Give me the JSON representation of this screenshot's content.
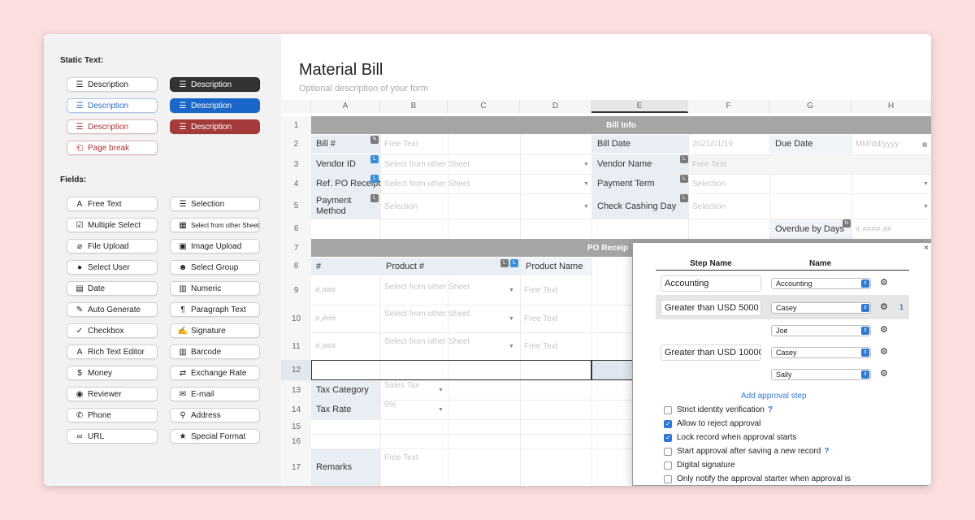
{
  "window": {
    "dots": [
      "#ed6a5e",
      "#f5bf4f",
      "#62c554"
    ]
  },
  "sidebar": {
    "static_title": "Static Text:",
    "static_items": [
      {
        "label": "Description",
        "icon": "align-lines-icon",
        "style": "plain"
      },
      {
        "label": "Description",
        "icon": "align-lines-icon",
        "style": "dark"
      },
      {
        "label": "Description",
        "icon": "align-lines-icon",
        "style": "blue-outline"
      },
      {
        "label": "Description",
        "icon": "align-lines-icon",
        "style": "blue-filled"
      },
      {
        "label": "Description",
        "icon": "align-lines-icon",
        "style": "red-outline"
      },
      {
        "label": "Description",
        "icon": "align-lines-icon",
        "style": "red-filled"
      },
      {
        "label": "Page break",
        "icon": "page-break-icon",
        "style": "red-outline"
      }
    ],
    "fields_title": "Fields:",
    "fields": [
      {
        "label": "Free Text",
        "icon": "font-icon",
        "glyph": "A"
      },
      {
        "label": "Selection",
        "icon": "list-icon",
        "glyph": "☰"
      },
      {
        "label": "Multiple Select",
        "icon": "checkbox-icon",
        "glyph": "☑"
      },
      {
        "label": "Select from other Sheet",
        "icon": "table-icon",
        "glyph": "▦"
      },
      {
        "label": "File Upload",
        "icon": "paperclip-icon",
        "glyph": "⌀"
      },
      {
        "label": "Image Upload",
        "icon": "image-icon",
        "glyph": "▣"
      },
      {
        "label": "Select User",
        "icon": "user-icon",
        "glyph": "●"
      },
      {
        "label": "Select Group",
        "icon": "users-icon",
        "glyph": "☻"
      },
      {
        "label": "Date",
        "icon": "calendar-icon",
        "glyph": "▤"
      },
      {
        "label": "Numeric",
        "icon": "calculator-icon",
        "glyph": "▥"
      },
      {
        "label": "Auto Generate",
        "icon": "magic-wand-icon",
        "glyph": "✎"
      },
      {
        "label": "Paragraph Text",
        "icon": "paragraph-icon",
        "glyph": "¶"
      },
      {
        "label": "Checkbox",
        "icon": "check-icon",
        "glyph": "✓"
      },
      {
        "label": "Signature",
        "icon": "signature-icon",
        "glyph": "✍"
      },
      {
        "label": "Rich Text Editor",
        "icon": "font-icon",
        "glyph": "A"
      },
      {
        "label": "Barcode",
        "icon": "barcode-icon",
        "glyph": "▥"
      },
      {
        "label": "Money",
        "icon": "dollar-icon",
        "glyph": "$"
      },
      {
        "label": "Exchange Rate",
        "icon": "exchange-icon",
        "glyph": "⇄"
      },
      {
        "label": "Reviewer",
        "icon": "eye-icon",
        "glyph": "◉"
      },
      {
        "label": "E-mail",
        "icon": "envelope-icon",
        "glyph": "✉"
      },
      {
        "label": "Phone",
        "icon": "phone-icon",
        "glyph": "✆"
      },
      {
        "label": "Address",
        "icon": "map-marker-icon",
        "glyph": "⚲"
      },
      {
        "label": "URL",
        "icon": "link-icon",
        "glyph": "∞"
      },
      {
        "label": "Special Format",
        "icon": "star-icon",
        "glyph": "★"
      }
    ]
  },
  "form": {
    "title": "Material Bill",
    "description": "Optional description of your form"
  },
  "grid": {
    "columns": [
      "A",
      "B",
      "C",
      "D",
      "E",
      "F",
      "G",
      "H"
    ],
    "rows": [
      "1",
      "2",
      "3",
      "4",
      "5",
      "6",
      "7",
      "8",
      "9",
      "10",
      "11",
      "12",
      "13",
      "14",
      "15",
      "16",
      "17"
    ],
    "band_bill_info": "Bill Info",
    "band_po_receipt": "PO Receip",
    "labels": {
      "bill_no": "Bill #",
      "vendor_id": "Vendor ID",
      "ref_po": "Ref. PO Receipt",
      "payment_method": "Payment Method",
      "bill_date": "Bill Date",
      "vendor_name": "Vendor Name",
      "payment_term": "Payment Term",
      "check_cashing_day": "Check Cashing Day",
      "due_date": "Due Date",
      "overdue": "Overdue by Days",
      "po_no": "#",
      "product_no": "Product #",
      "product_name": "Product Name",
      "tax_category": "Tax Category",
      "tax_rate": "Tax Rate",
      "remarks": "Remarks"
    },
    "placeholders": {
      "free_text": "Free Text",
      "select_other_sheet": "Select from other Sheet",
      "selection": "Selection",
      "date_value": "2021/01/19",
      "date_format": "MM/dd/yyyy",
      "number_format": "#,####.##",
      "hash_format": "#,###",
      "sales_tax": "Sales Tax",
      "zero_pct": "0%"
    }
  },
  "approval": {
    "close": "×",
    "col_step": "Step Name",
    "col_name": "Name",
    "steps": [
      {
        "step": "Accounting",
        "approvers": [
          "Accounting"
        ]
      },
      {
        "step": "Greater than USD 5000",
        "approvers": [
          "Casey",
          "Joe"
        ],
        "badge": "1"
      },
      {
        "step": "Greater than USD 10000",
        "approvers": [
          "Casey",
          "Sally"
        ]
      }
    ],
    "add_step": "Add approval step",
    "options": [
      {
        "label": "Strict identity verification",
        "checked": false,
        "help": "?"
      },
      {
        "label": "Allow to reject approval",
        "checked": true
      },
      {
        "label": "Lock record when approval starts",
        "checked": true
      },
      {
        "label": "Start approval after saving a new record",
        "checked": false,
        "help": "?"
      },
      {
        "label": "Digital signature",
        "checked": false
      },
      {
        "label": "Only notify the approval starter when approval is",
        "checked": false
      }
    ]
  }
}
